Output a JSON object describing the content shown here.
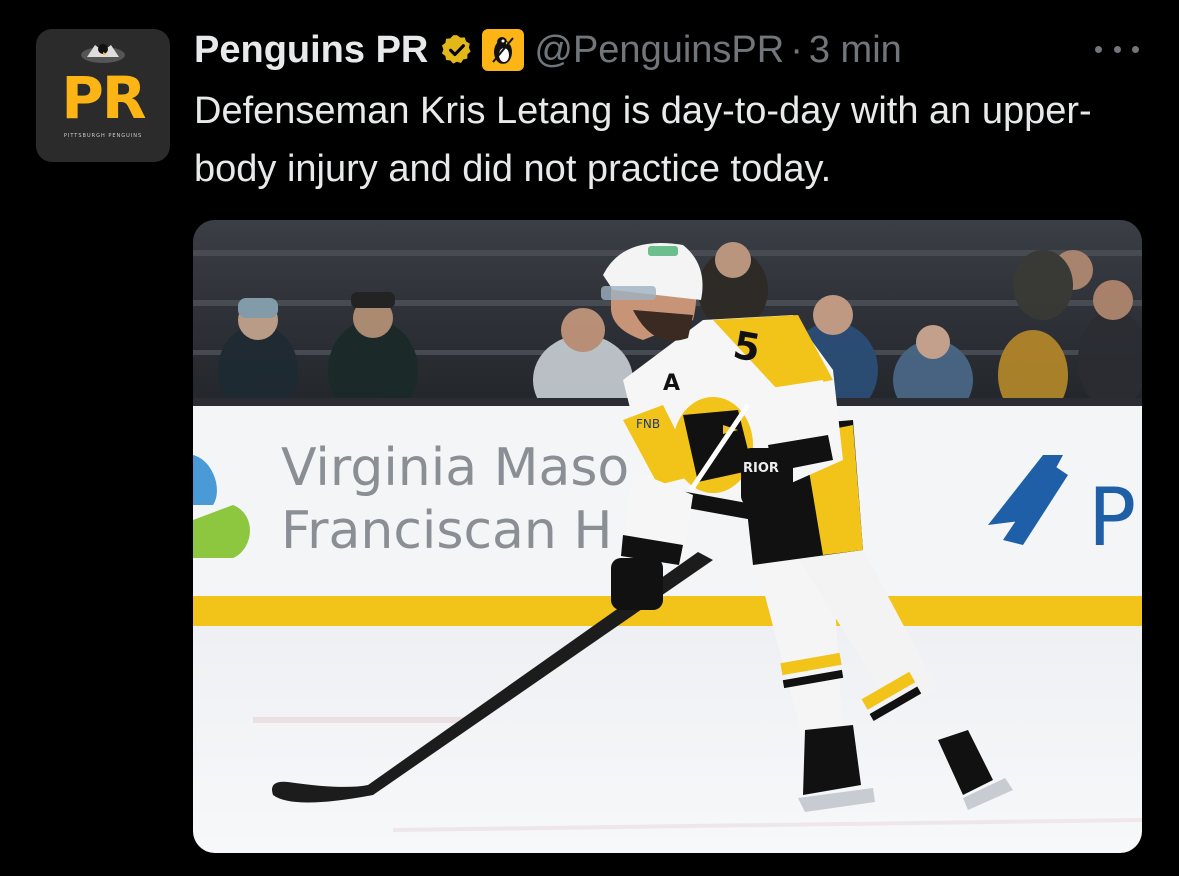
{
  "account": {
    "display_name": "Penguins PR",
    "handle": "@PenguinsPR",
    "separator": "·",
    "time": "3 min",
    "avatar_text": "PR",
    "avatar_subtext": "PITTSBURGH PENGUINS",
    "verified_icon": "verified-badge-icon",
    "affiliate_icon": "penguin-logo-icon"
  },
  "tweet": {
    "text": "Defenseman Kris Letang is day-to-day with an upper-body injury and did not practice today."
  },
  "media": {
    "board_line1": "Virginia Maso",
    "board_line2": "Franciscan H",
    "board_right_letter": "P",
    "jersey_number": "5",
    "captain_letter": "A",
    "glove_text": "RIOR",
    "sponsor_patch": "FNB"
  },
  "colors": {
    "background": "#000000",
    "text_primary": "#e7e9ea",
    "text_secondary": "#71767b",
    "penguins_gold": "#fcb514",
    "verified_gold": "#e2b719"
  }
}
